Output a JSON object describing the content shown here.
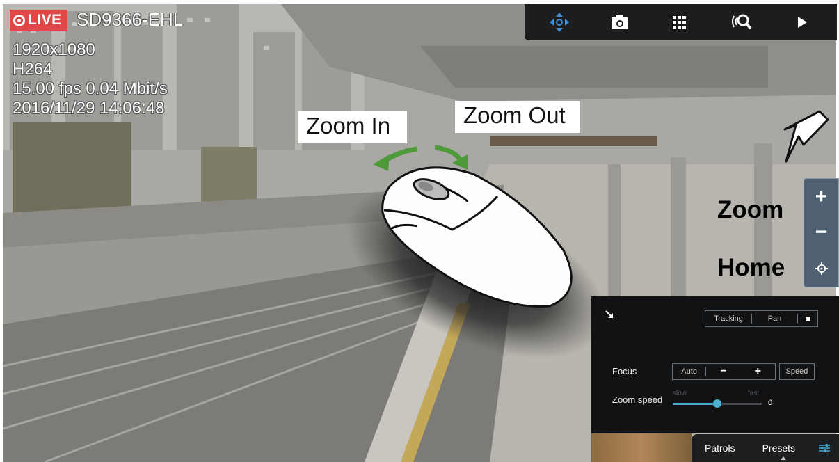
{
  "osd": {
    "live_label": "LIVE",
    "model": "SD9366-EHL",
    "resolution": "1920x1080",
    "codec": "H264",
    "rate": "15.00 fps 0.04 Mbit/s",
    "timestamp": "2016/11/29 14:06:48"
  },
  "toolbar": {
    "items": [
      {
        "icon": "ptz-move-icon",
        "color": "#3d8fd8"
      },
      {
        "icon": "camera-snapshot-icon"
      },
      {
        "icon": "grid-layout-icon"
      },
      {
        "icon": "audio-search-icon"
      },
      {
        "icon": "play-icon"
      }
    ]
  },
  "callouts": {
    "zoom_in": "Zoom In",
    "zoom_out": "Zoom Out",
    "zoom": "Zoom",
    "home": "Home"
  },
  "zoom_panel": {
    "plus": "+",
    "minus": "−",
    "home_icon": "home-target-icon"
  },
  "ptz_panel": {
    "mode_tracking": "Tracking",
    "mode_pan": "Pan",
    "focus_label": "Focus",
    "focus_auto": "Auto",
    "focus_minus": "−",
    "focus_plus": "+",
    "focus_speed": "Speed",
    "zoom_speed_label": "Zoom speed",
    "slow": "slow",
    "fast": "fast",
    "zoom_speed_value": "0",
    "zoom_speed_level": 0.5
  },
  "tabs": {
    "patrols": "Patrols",
    "presets": "Presets"
  },
  "colors": {
    "live_badge": "#e04848",
    "accent": "#44a6c6",
    "panel_bg": "#111214",
    "zoom_panel": "#4f6173"
  }
}
